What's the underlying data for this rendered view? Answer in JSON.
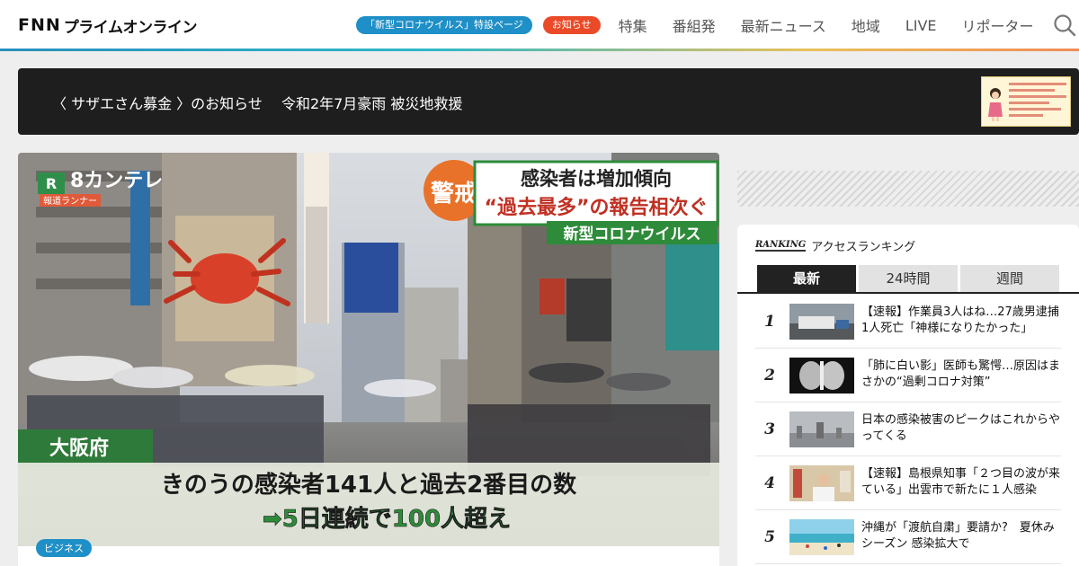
{
  "header": {
    "logo_fnn": "FNN",
    "logo_jp": "プライムオンライン",
    "pill_corona": "「新型コロナウイルス」特設ページ",
    "pill_notice": "お知らせ",
    "nav": [
      "特集",
      "番組発",
      "最新ニュース",
      "地域",
      "LIVE",
      "リポーター"
    ]
  },
  "banner": {
    "text": "〈 サザエさん募金 〉のお知らせ　 令和2年7月豪雨 被災地救援"
  },
  "hero": {
    "station_logo": "8カンテレ",
    "station_sub": "報道ランナー",
    "badge": "警戒",
    "headline_1": "感染者は増加傾向",
    "headline_2": "“過去最多”の報告相次ぐ",
    "topic": "新型コロナウイルス",
    "location": "大阪府",
    "caption_1": "きのうの感染者141人と過去2番目の数",
    "caption_2": "➡5日連続で100人超え",
    "category_tag": "ビジネス"
  },
  "ranking": {
    "logo": "RANKING",
    "title": "アクセスランキング",
    "tabs": [
      "最新",
      "24時間",
      "週間"
    ],
    "items": [
      {
        "rank": "1",
        "text": "【速報】作業員3人はね…27歳男逮捕　1人死亡「神様になりたかった」"
      },
      {
        "rank": "2",
        "text": "「肺に白い影」医師も驚愕…原因はまさかの“過剰コロナ対策”"
      },
      {
        "rank": "3",
        "text": "日本の感染被害のピークはこれからやってくる"
      },
      {
        "rank": "4",
        "text": "【速報】島根県知事「２つ目の波が来ている」出雲市で新たに１人感染"
      },
      {
        "rank": "5",
        "text": "沖縄が「渡航自粛」要請か?　夏休みシーズン 感染拡大で"
      }
    ]
  },
  "colors": {
    "accent_blue": "#1f8fc7",
    "notice_red": "#ea4a28",
    "telop_green": "#2e8b3a"
  }
}
